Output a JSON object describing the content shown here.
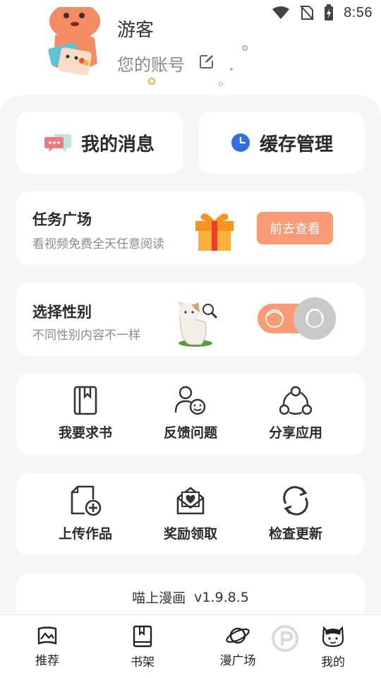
{
  "status_bar": {
    "time": "8:56"
  },
  "profile": {
    "username": "游客",
    "account_label": "您的账号"
  },
  "quick_actions": [
    {
      "label": "我的消息",
      "icon": "message-icon"
    },
    {
      "label": "缓存管理",
      "icon": "clock-icon"
    }
  ],
  "task_square": {
    "title": "任务广场",
    "subtitle": "看视频免费全天任意阅读",
    "button_label": "前去查看"
  },
  "gender": {
    "title": "选择性别",
    "subtitle": "不同性别内容不一样"
  },
  "grid_row1": [
    {
      "label": "我要求书",
      "icon": "book-icon"
    },
    {
      "label": "反馈问题",
      "icon": "feedback-icon"
    },
    {
      "label": "分享应用",
      "icon": "share-icon"
    }
  ],
  "grid_row2": [
    {
      "label": "上传作品",
      "icon": "upload-icon"
    },
    {
      "label": "奖励领取",
      "icon": "reward-icon"
    },
    {
      "label": "检查更新",
      "icon": "refresh-icon"
    }
  ],
  "version": {
    "app_name": "喵上漫画",
    "number": "v1.9.8.5"
  },
  "bottom_nav": [
    {
      "label": "推荐",
      "icon": "recommend-icon"
    },
    {
      "label": "书架",
      "icon": "bookshelf-icon"
    },
    {
      "label": "漫广场",
      "icon": "planet-icon"
    },
    {
      "label": "我的",
      "icon": "cat-avatar-icon"
    }
  ],
  "colors": {
    "accent": "#fb9b75",
    "panel_bg": "#f6f6f6",
    "text_dark": "#2a2a2a",
    "text_muted": "#8a8a8a"
  }
}
